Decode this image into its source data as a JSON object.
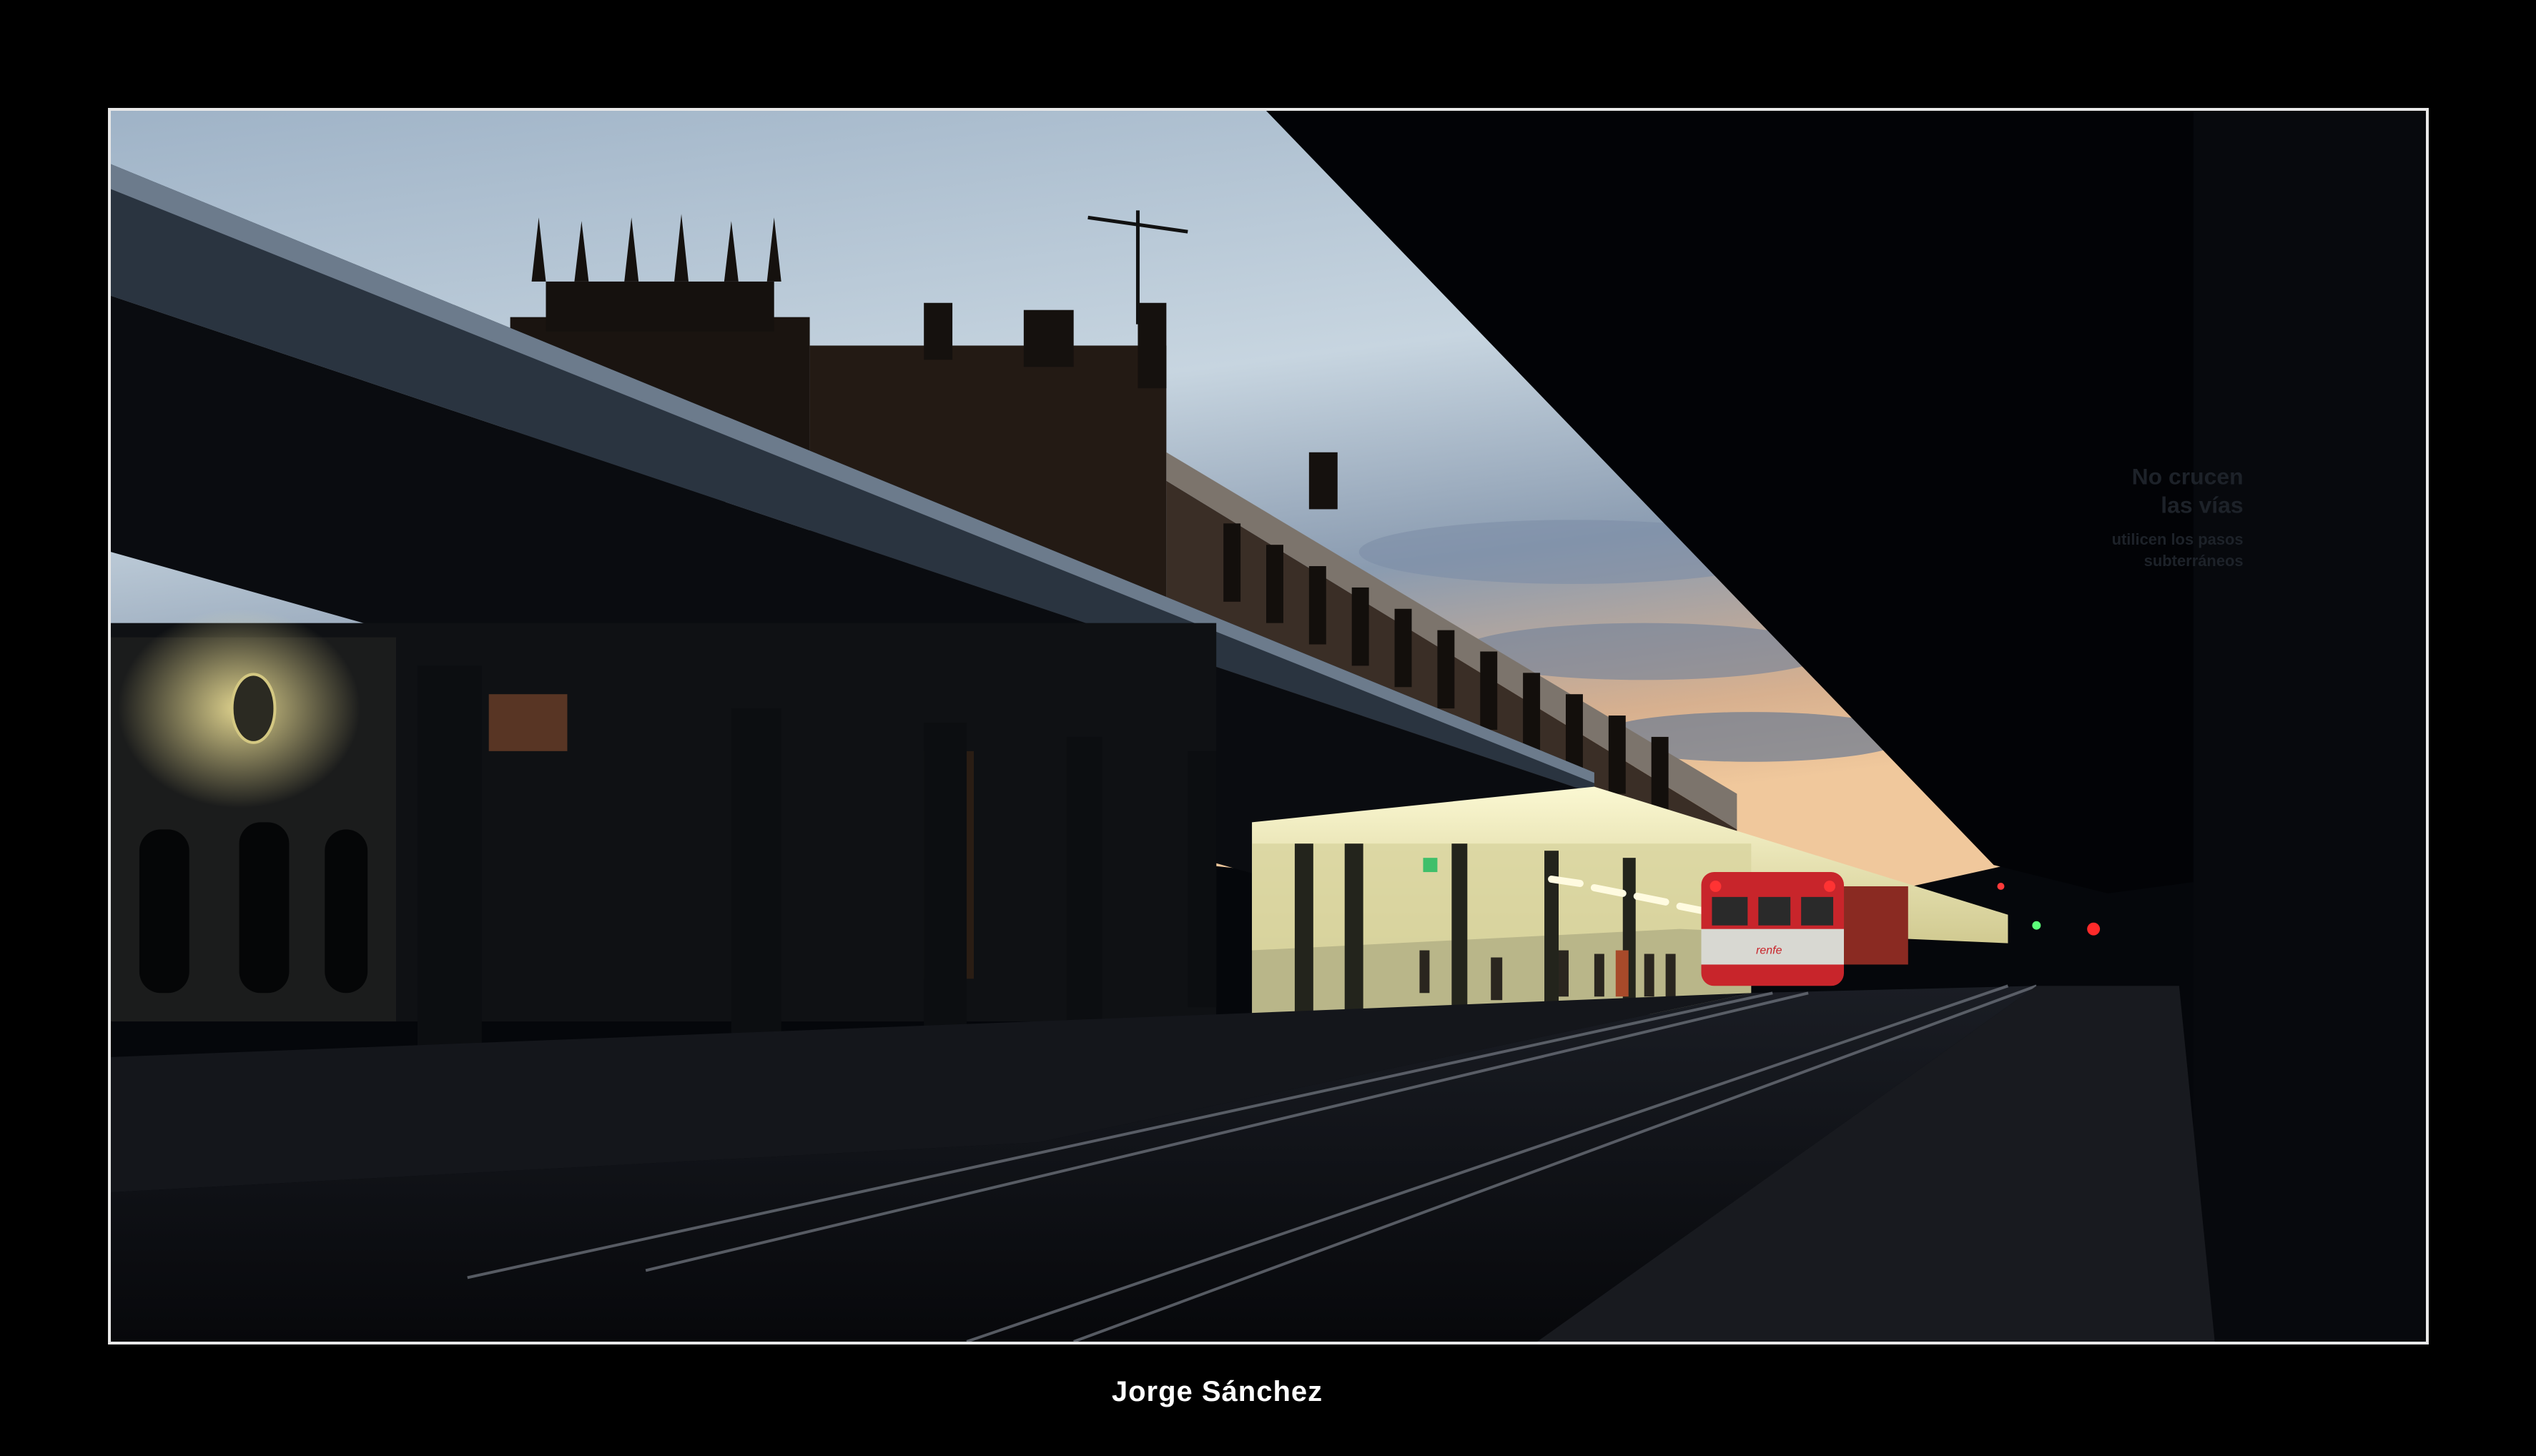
{
  "photo": {
    "subject": "train station platform at dusk",
    "sign_lines": [
      "No crucen",
      "las vías",
      "utilicen los pasos",
      "subterráneos"
    ],
    "train_logo": "renfe",
    "colors": {
      "sky_top": "#9fb6cc",
      "sky_mid": "#c9d7e2",
      "sky_horizon": "#e9c8a0",
      "canopy_light": "#f3f0c8",
      "train_red": "#c8252b"
    }
  },
  "caption": {
    "author": "Jorge Sánchez"
  }
}
